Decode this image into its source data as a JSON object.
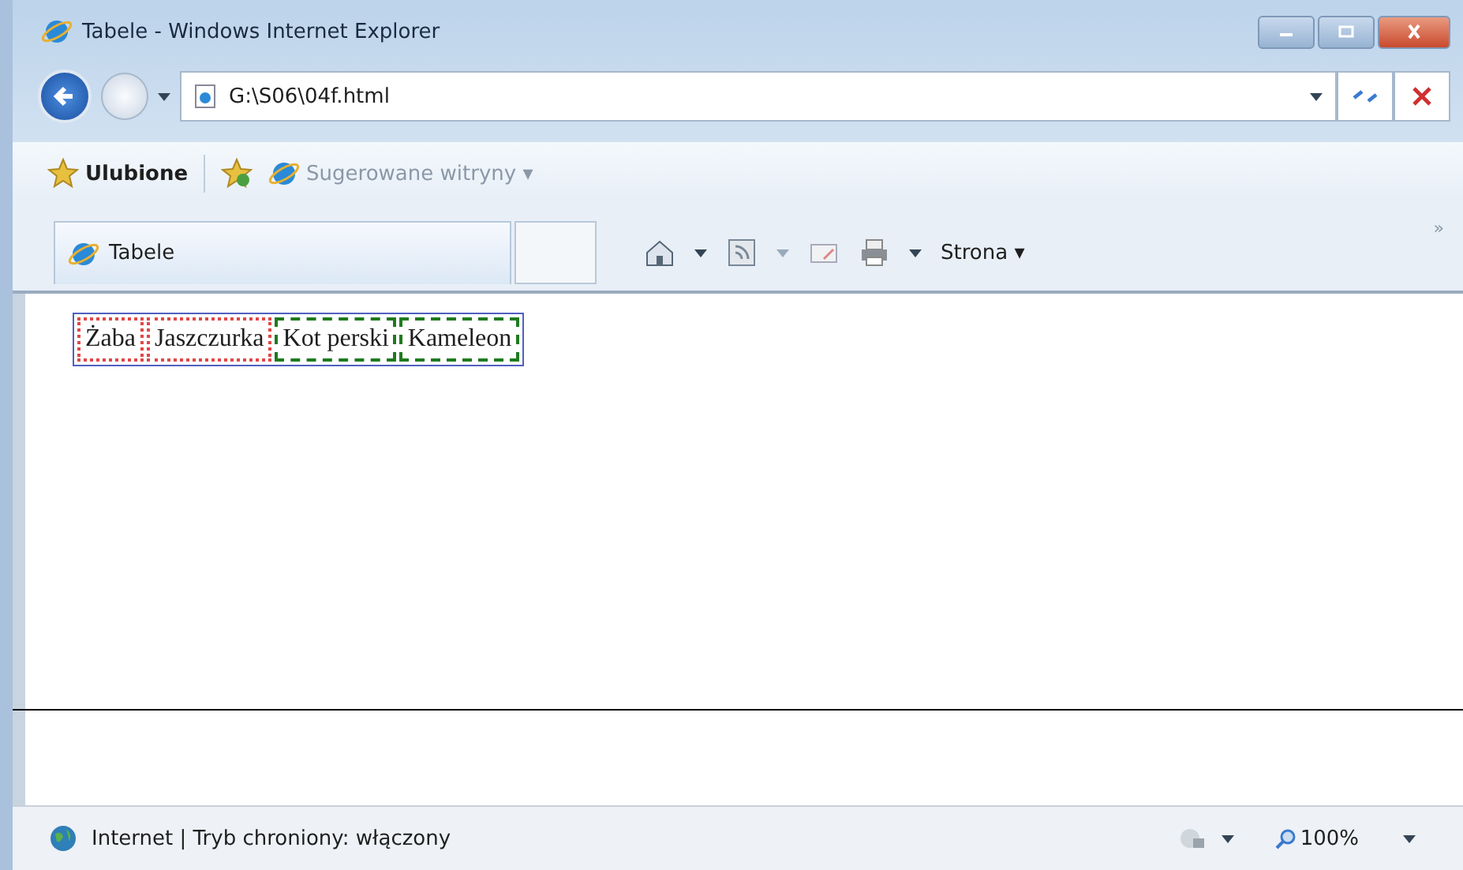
{
  "window": {
    "title": "Tabele - Windows Internet Explorer"
  },
  "address_bar": {
    "value": "G:\\S06\\04f.html"
  },
  "favorites_bar": {
    "favorites": "Ulubione",
    "suggested": "Sugerowane witryny ▾"
  },
  "tabs": [
    {
      "label": "Tabele",
      "selected": true
    }
  ],
  "command_bar": {
    "page_menu": "Strona ▾",
    "more": "»"
  },
  "table": {
    "cells": [
      {
        "text": "Żaba",
        "kind": "dotted",
        "color": "#e04848"
      },
      {
        "text": "Jaszczurka",
        "kind": "dotted",
        "color": "#e04848"
      },
      {
        "text": "Kot perski",
        "kind": "dashed",
        "color": "#1f7a1f"
      },
      {
        "text": "Kameleon",
        "kind": "dashed",
        "color": "#1f7a1f"
      }
    ]
  },
  "status_bar": {
    "zone": "Internet | Tryb chroniony: włączony",
    "zoom": "100%"
  }
}
